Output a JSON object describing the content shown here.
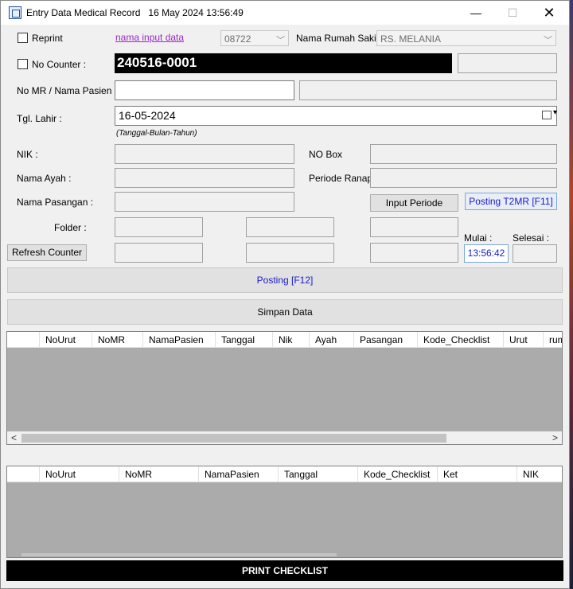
{
  "window": {
    "title": "Entry Data Medical Record",
    "datetime": "16 May 2024 13:56:49",
    "minimize": "—",
    "maximize": "☐",
    "close": "✕"
  },
  "form": {
    "reprint_label": "Reprint",
    "nama_input_link": "nama input data",
    "code_combo_value": "08722",
    "nama_rs_label": "Nama Rumah Sakit",
    "rs_combo_value": "RS. MELANIA",
    "no_counter_label": "No Counter :",
    "counter_value": "240516-0001",
    "no_mr_label": "No MR / Nama Pasien :",
    "tgl_lahir_label": "Tgl. Lahir :",
    "tgl_lahir_value": "16-05-2024",
    "date_hint": "(Tanggal-Bulan-Tahun)",
    "nik_label": "NIK :",
    "no_box_label": "NO Box",
    "nama_ayah_label": "Nama Ayah :",
    "periode_ranap_label": "Periode Ranap",
    "nama_pasangan_label": "Nama Pasangan :",
    "input_periode_button": "Input Periode",
    "posting_t2mr_button": "Posting T2MR [F11]",
    "folder_label": "Folder :",
    "refresh_counter_button": "Refresh Counter",
    "mulai_label": "Mulai :",
    "selesai_label": "Selesai :",
    "mulai_value": "13:56:42",
    "posting_f12_button": "Posting [F12]",
    "simpan_data_button": "Simpan Data"
  },
  "grid1": {
    "columns": [
      "NoUrut",
      "NoMR",
      "NamaPasien",
      "Tanggal",
      "Nik",
      "Ayah",
      "Pasangan",
      "Kode_Checklist",
      "Urut",
      "rum"
    ]
  },
  "grid2": {
    "columns": [
      "NoUrut",
      "NoMR",
      "NamaPasien",
      "Tanggal",
      "Kode_Checklist",
      "Ket",
      "NIK"
    ]
  },
  "print_button": "PRINT CHECKLIST",
  "scroll_left": "<",
  "scroll_right": ">"
}
